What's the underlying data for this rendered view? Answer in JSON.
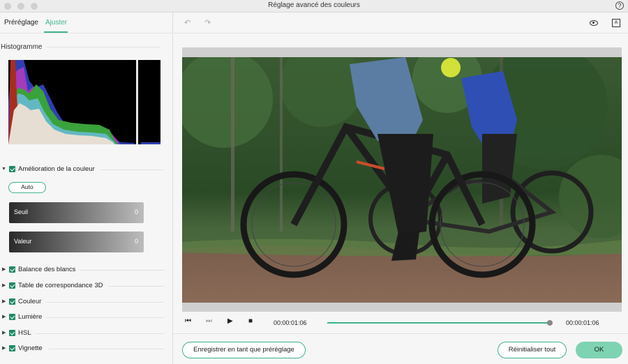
{
  "window": {
    "title": "Réglage avancé des couleurs",
    "help": "?"
  },
  "tabs": {
    "preset": "Préréglage",
    "adjust": "Ajuster"
  },
  "histogram": {
    "label": "Histogramme"
  },
  "color_enhancement": {
    "label": "Amélioration de la couleur",
    "auto_label": "Auto",
    "sliders": [
      {
        "label": "Seuil",
        "value": "0"
      },
      {
        "label": "Valeur",
        "value": "0"
      }
    ]
  },
  "sections": [
    {
      "label": "Balance des blancs"
    },
    {
      "label": "Table de correspondance 3D"
    },
    {
      "label": "Couleur"
    },
    {
      "label": "Lumière"
    },
    {
      "label": "HSL"
    },
    {
      "label": "Vignette"
    }
  ],
  "toolbar": {
    "undo_icon": "undo-icon",
    "redo_icon": "redo-icon",
    "eye_icon": "eye-icon",
    "compare_icon": "compare-icon",
    "compare_glyph": "A"
  },
  "playback": {
    "current_time": "00:00:01:06",
    "total_time": "00:00:01:06",
    "progress": 1.0
  },
  "buttons": {
    "save_preset": "Enregistrer en tant que préréglage",
    "reset_all": "Réinitialiser tout",
    "ok": "OK"
  },
  "colors": {
    "accent": "#3fb28e",
    "ok_fill": "#7ed3b2"
  }
}
